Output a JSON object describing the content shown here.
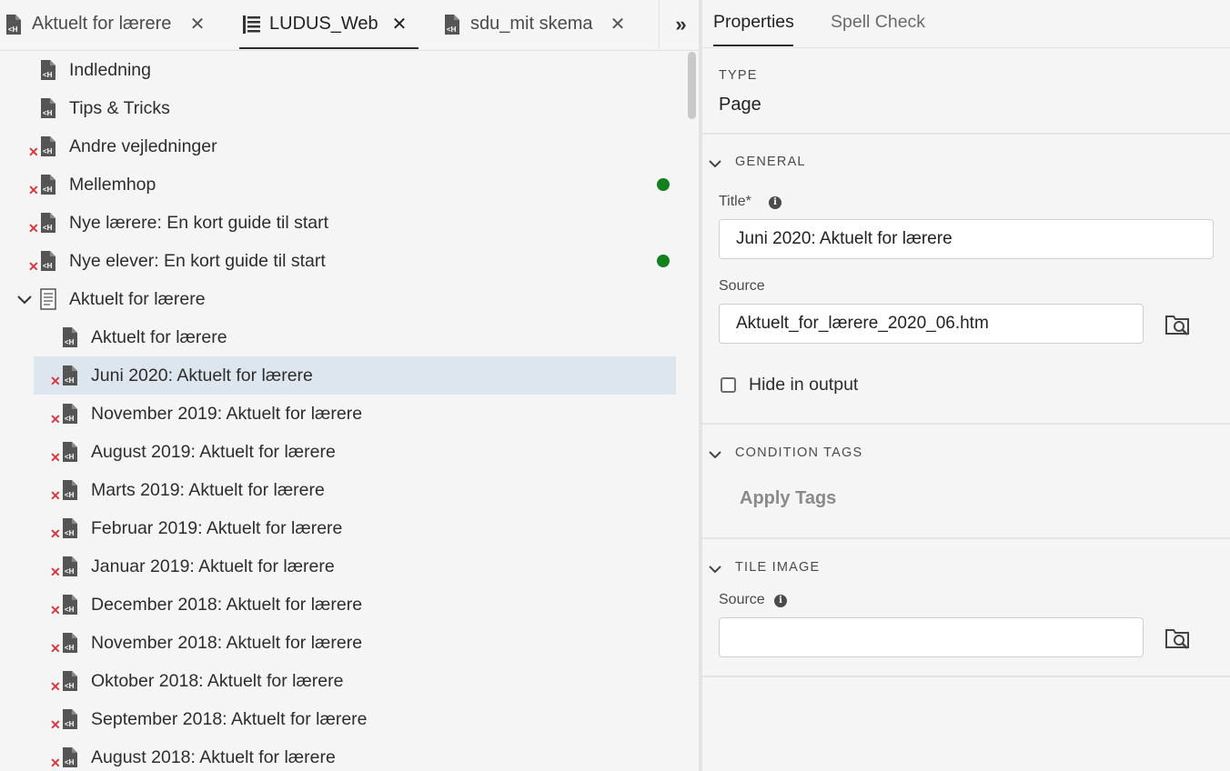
{
  "tabs": [
    {
      "label": "Aktuelt for lærere",
      "icon": "html-file-icon",
      "active": false
    },
    {
      "label": "LUDUS_Web",
      "icon": "toc-icon",
      "active": true
    },
    {
      "label": "sdu_mit skema",
      "icon": "html-file-icon",
      "active": false
    }
  ],
  "tab_close_glyph": "✕",
  "overflow_glyph": "»",
  "tree": {
    "items": [
      {
        "label": "Indledning",
        "level": 0,
        "error": false,
        "status_dot": false,
        "icon": "html-file-icon"
      },
      {
        "label": "Tips & Tricks",
        "level": 0,
        "error": false,
        "status_dot": false,
        "icon": "html-file-icon"
      },
      {
        "label": "Andre vejledninger",
        "level": 0,
        "error": true,
        "status_dot": false,
        "icon": "html-file-icon"
      },
      {
        "label": "Mellemhop",
        "level": 0,
        "error": true,
        "status_dot": true,
        "icon": "html-file-icon"
      },
      {
        "label": "Nye lærere: En kort guide til start",
        "level": 0,
        "error": true,
        "status_dot": false,
        "icon": "html-file-icon"
      },
      {
        "label": "Nye elever: En kort guide til start",
        "level": 0,
        "error": true,
        "status_dot": true,
        "icon": "html-file-icon"
      },
      {
        "label": "Aktuelt for lærere",
        "level": 0,
        "error": false,
        "status_dot": false,
        "icon": "document-icon",
        "expanded": true
      },
      {
        "label": "Aktuelt for lærere",
        "level": 1,
        "error": false,
        "status_dot": false,
        "icon": "html-file-icon"
      },
      {
        "label": "Juni 2020: Aktuelt for lærere",
        "level": 1,
        "error": true,
        "status_dot": false,
        "icon": "html-file-icon",
        "selected": true
      },
      {
        "label": "November 2019: Aktuelt for lærere",
        "level": 1,
        "error": true,
        "status_dot": false,
        "icon": "html-file-icon"
      },
      {
        "label": "August 2019: Aktuelt for lærere",
        "level": 1,
        "error": true,
        "status_dot": false,
        "icon": "html-file-icon"
      },
      {
        "label": "Marts 2019: Aktuelt for lærere",
        "level": 1,
        "error": true,
        "status_dot": false,
        "icon": "html-file-icon"
      },
      {
        "label": "Februar 2019: Aktuelt for lærere",
        "level": 1,
        "error": true,
        "status_dot": false,
        "icon": "html-file-icon"
      },
      {
        "label": "Januar 2019: Aktuelt for lærere",
        "level": 1,
        "error": true,
        "status_dot": false,
        "icon": "html-file-icon"
      },
      {
        "label": "December 2018: Aktuelt for lærere",
        "level": 1,
        "error": true,
        "status_dot": false,
        "icon": "html-file-icon"
      },
      {
        "label": "November 2018: Aktuelt for lærere",
        "level": 1,
        "error": true,
        "status_dot": false,
        "icon": "html-file-icon"
      },
      {
        "label": "Oktober 2018: Aktuelt for lærere",
        "level": 1,
        "error": true,
        "status_dot": false,
        "icon": "html-file-icon"
      },
      {
        "label": "September 2018: Aktuelt for lærere",
        "level": 1,
        "error": true,
        "status_dot": false,
        "icon": "html-file-icon"
      },
      {
        "label": "August 2018: Aktuelt for lærere",
        "level": 1,
        "error": true,
        "status_dot": false,
        "icon": "html-file-icon"
      }
    ]
  },
  "error_glyph": "✕",
  "colors": {
    "status_dot": "#12801d",
    "error_mark": "#d7373f",
    "selected_row": "#dde6ee"
  },
  "panel": {
    "tabs": {
      "properties": "Properties",
      "spell_check": "Spell Check"
    },
    "type_label": "TYPE",
    "type_value": "Page",
    "general": {
      "heading": "GENERAL",
      "title_label": "Title*",
      "title_value": "Juni 2020: Aktuelt for lærere",
      "source_label": "Source",
      "source_value": "Aktuelt_for_lærere_2020_06.htm",
      "hide_label": "Hide in output",
      "hide_checked": false
    },
    "condition_tags": {
      "heading": "CONDITION TAGS",
      "apply_label": "Apply Tags"
    },
    "tile_image": {
      "heading": "TILE IMAGE",
      "source_label": "Source",
      "source_value": ""
    }
  }
}
